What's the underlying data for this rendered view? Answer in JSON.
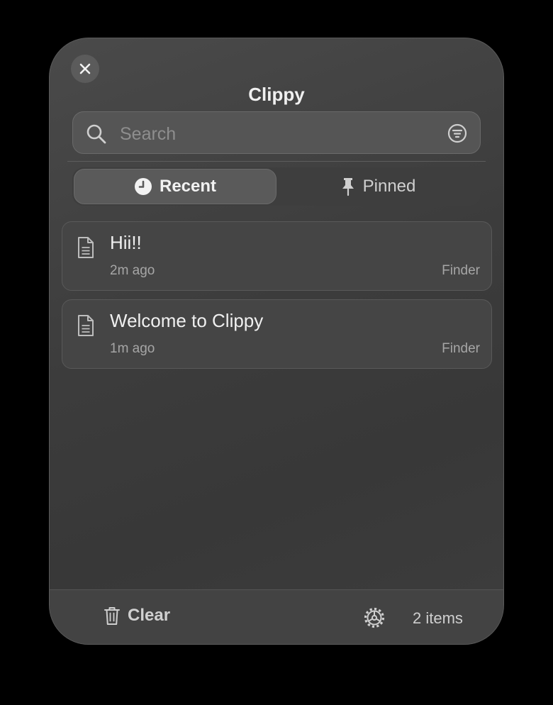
{
  "app": {
    "title": "Clippy"
  },
  "search": {
    "placeholder": "Search",
    "value": ""
  },
  "tabs": [
    {
      "label": "Recent",
      "icon": "clock-icon",
      "selected": true
    },
    {
      "label": "Pinned",
      "icon": "pin-icon",
      "selected": false
    }
  ],
  "clips": [
    {
      "text": "Hii!!",
      "time": "2m ago",
      "source": "Finder",
      "icon": "document-icon"
    },
    {
      "text": "Welcome to Clippy",
      "time": "1m ago",
      "source": "Finder",
      "icon": "document-icon"
    }
  ],
  "footer": {
    "clear_label": "Clear",
    "count_label": "2 items"
  },
  "colors": {
    "background": "#000000",
    "panel": "#3f3f3f",
    "text": "#f0f0f0",
    "muted": "#a6a6a6"
  }
}
